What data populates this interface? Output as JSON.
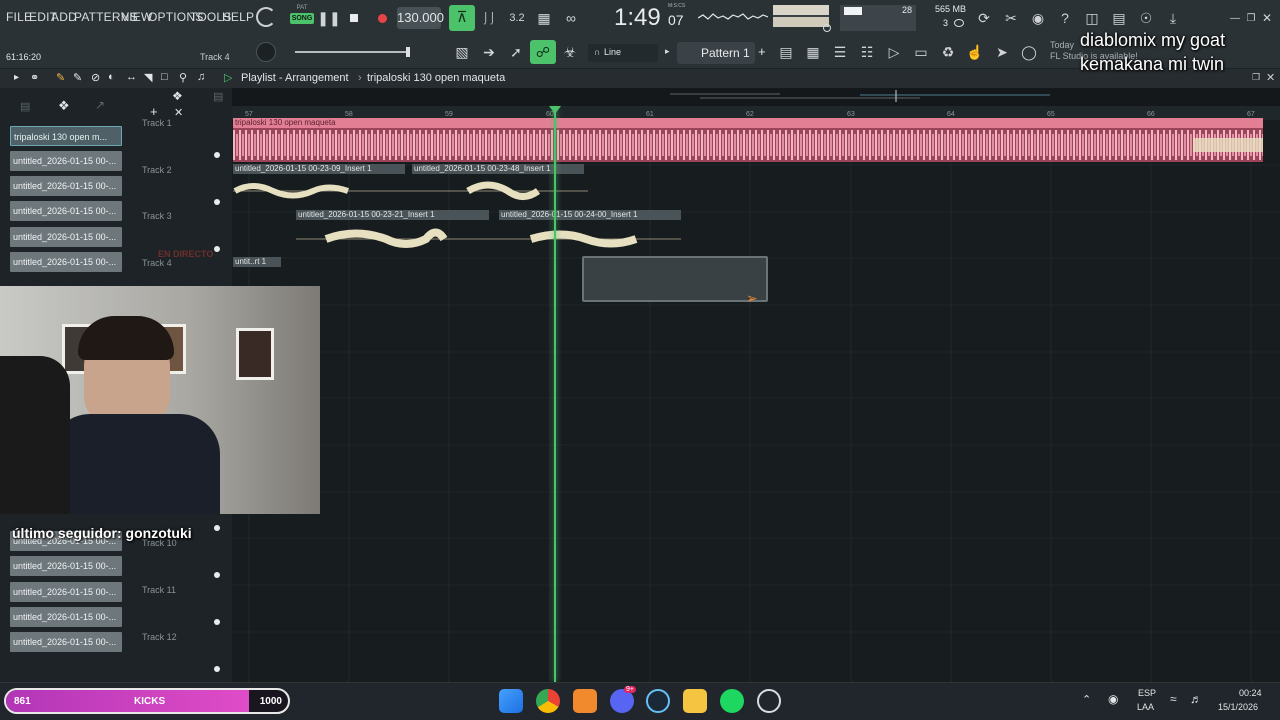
{
  "menu": [
    "FILE",
    "EDIT",
    "ADD",
    "PATTERNS",
    "VIEW",
    "OPTIONS",
    "TOOLS",
    "HELP"
  ],
  "transport": {
    "pat_label": "PAT",
    "song_label": "SONG",
    "tempo": "130.000",
    "time_main": "1:49",
    "time_sub": "07",
    "time_unit": "M:S:CS",
    "cpu_value": "28",
    "memory": "565 MB",
    "polyphony": "3"
  },
  "row2": {
    "position": "61:16:20",
    "hint": "Track 4",
    "snap": "Line",
    "pattern": "Pattern 1",
    "news_today": "Today",
    "news_text": "FL Studio is available!"
  },
  "playlist_bar": {
    "title": "Playlist - Arrangement",
    "separator": "›",
    "project": "tripaloski 130 open maqueta"
  },
  "ruler": [
    "57",
    "58",
    "59",
    "60",
    "61",
    "62",
    "63",
    "64",
    "65",
    "66",
    "67"
  ],
  "picker": [
    "tripaloski 130 open m...",
    "untitled_2026-01-15 00-...",
    "untitled_2026-01-15 00-...",
    "untitled_2026-01-15 00-...",
    "untitled_2026-01-15 00-...",
    "untitled_2026-01-15 00-...",
    "untitled_2026-01-15 00-...",
    "untitled_2026-01-15 00-...",
    "untitled_2026-01-15 00-...",
    "untitled_2026-01-15 00-...",
    "untitled_2026-01-15 00-..."
  ],
  "tracks": [
    "Track 1",
    "Track 2",
    "Track 3",
    "Track 4",
    "Track 10",
    "Track 11",
    "Track 12"
  ],
  "clips": {
    "t1": "tripaloski 130 open maqueta",
    "t2a": "untitled_2026-01-15 00-23-09_Insert 1",
    "t2b": "untitled_2026-01-15 00-23-48_Insert 1",
    "t3a": "untitled_2026-01-15 00-23-21_Insert 1",
    "t3b": "untitled_2026-01-15 00-24-00_Insert 1",
    "t4": "untit..rt 1"
  },
  "overlays": {
    "line1": "diablomix my goat",
    "line2": "kemakana mi twin",
    "follower": "último seguidor: gonzotuki",
    "live": "EN DIRECTO"
  },
  "goal": {
    "current": "861",
    "label": "KICKS",
    "target": "1000",
    "progress": 0.861
  },
  "taskbar": {
    "lang": "ESP",
    "layout": "LAA",
    "time": "00:24",
    "date": "15/1/2026",
    "badge": "9+"
  },
  "colors": {
    "accent_green": "#4cc36a",
    "clip_red": "#e37f95",
    "wave_cream": "#e7e0c0",
    "goal_pink": "#d33bb8"
  }
}
